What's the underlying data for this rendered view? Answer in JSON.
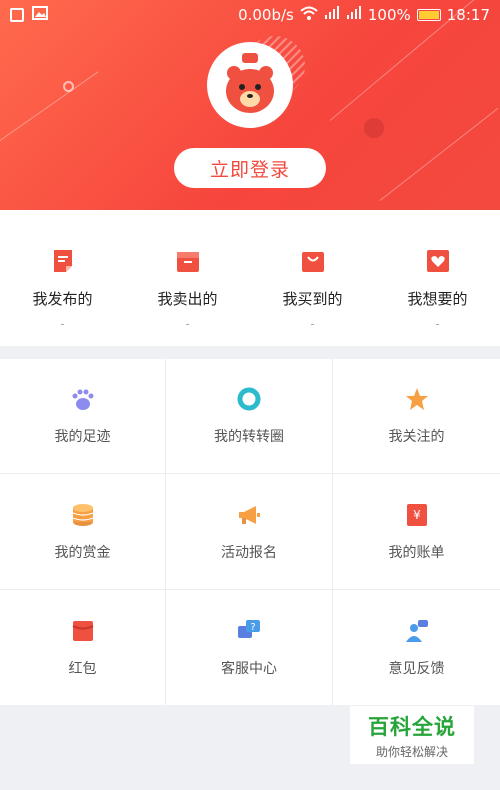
{
  "status_bar": {
    "net_speed": "0.00b/s",
    "battery": "100%",
    "time": "18:17",
    "icons": [
      "add-box-icon",
      "image-icon",
      "wifi-icon",
      "signal-icon",
      "signal-icon",
      "battery-icon"
    ]
  },
  "header": {
    "login_label": "立即登录",
    "avatar_icon": "bear-mascot-icon"
  },
  "quick_stats": [
    {
      "label": "我发布的",
      "count": "-",
      "icon": "document-icon"
    },
    {
      "label": "我卖出的",
      "count": "-",
      "icon": "box-icon"
    },
    {
      "label": "我买到的",
      "count": "-",
      "icon": "shopping-bag-icon"
    },
    {
      "label": "我想要的",
      "count": "-",
      "icon": "wishlist-heart-icon"
    }
  ],
  "menu": [
    {
      "label": "我的足迹",
      "icon": "paw-icon"
    },
    {
      "label": "我的转转圈",
      "icon": "circle-icon"
    },
    {
      "label": "我关注的",
      "icon": "star-icon"
    },
    {
      "label": "我的赏金",
      "icon": "coins-icon"
    },
    {
      "label": "活动报名",
      "icon": "megaphone-icon"
    },
    {
      "label": "我的账单",
      "icon": "bill-icon"
    },
    {
      "label": "红包",
      "icon": "red-packet-icon"
    },
    {
      "label": "客服中心",
      "icon": "customer-service-icon"
    },
    {
      "label": "意见反馈",
      "icon": "feedback-icon"
    }
  ],
  "watermark": {
    "title": "百科全说",
    "subtitle": "助你轻松解决"
  },
  "colors": {
    "brand_red": "#f6453d",
    "icon_red": "#ef5040",
    "paw_purple": "#8d8af0",
    "teal": "#2bbbcc",
    "orange": "#f6a043",
    "blue": "#5b7fe0",
    "watermark_green": "#27a53a"
  }
}
